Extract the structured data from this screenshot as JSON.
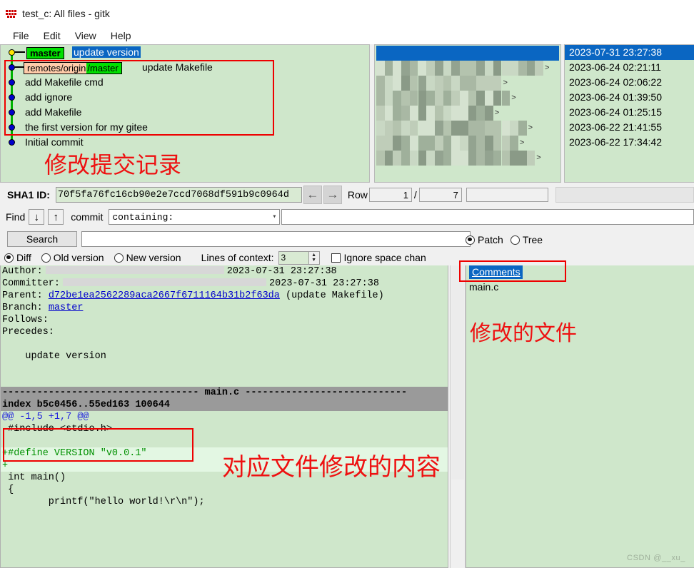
{
  "window": {
    "title": "test_c: All files - gitk",
    "icon": "gitk-app-icon"
  },
  "menubar": {
    "items": [
      "File",
      "Edit",
      "View",
      "Help"
    ]
  },
  "commit_list": {
    "rows": [
      {
        "refs": [
          {
            "text": "master",
            "style": "green"
          }
        ],
        "subject": "update version",
        "subject_highlighted": true,
        "author_redacted": true,
        "date": "2023-07-31 23:27:38",
        "selected": true,
        "node": "head"
      },
      {
        "refs": [
          {
            "text_a": "remotes/origin",
            "text_b": "/master",
            "style": "split"
          }
        ],
        "subject": "update Makefile",
        "subject_highlighted": false,
        "author_redacted": true,
        "date": "2023-06-24 02:21:11",
        "selected": false,
        "node": "commit"
      },
      {
        "refs": [],
        "subject": "add Makefile cmd",
        "subject_highlighted": false,
        "author_redacted": true,
        "date": "2023-06-24 02:06:22",
        "selected": false,
        "node": "commit"
      },
      {
        "refs": [],
        "subject": "add ignore",
        "subject_highlighted": false,
        "author_redacted": true,
        "date": "2023-06-24 01:39:50",
        "selected": false,
        "node": "commit"
      },
      {
        "refs": [],
        "subject": "add Makefile",
        "subject_highlighted": false,
        "author_redacted": true,
        "date": "2023-06-24 01:25:15",
        "selected": false,
        "node": "commit"
      },
      {
        "refs": [],
        "subject": "the first version for my gitee",
        "subject_highlighted": false,
        "author_redacted": true,
        "date": "2023-06-22 21:41:55",
        "selected": false,
        "node": "commit"
      },
      {
        "refs": [],
        "subject": "Initial commit",
        "subject_highlighted": false,
        "author_redacted": true,
        "date": "2023-06-22 17:34:42",
        "selected": false,
        "node": "commit"
      }
    ]
  },
  "sha_row": {
    "label": "SHA1 ID:",
    "value": "70f5fa76fc16cb90e2e7ccd7068df591b9c0964d",
    "back_arrow": "←",
    "forward_arrow": "→",
    "row_label": "Row",
    "row_current": "1",
    "row_separator": "/",
    "row_total": "7",
    "extra_value": ""
  },
  "find_row": {
    "label": "Find",
    "down_arrow": "↓",
    "up_arrow": "↑",
    "scope_label": "commit",
    "mode": "containing:",
    "chevron": "⌄",
    "query": ""
  },
  "search_row": {
    "button": "Search",
    "query": ""
  },
  "options_row": {
    "radios": [
      {
        "label": "Diff",
        "selected": true
      },
      {
        "label": "Old version",
        "selected": false
      },
      {
        "label": "New version",
        "selected": false
      }
    ],
    "context_label": "Lines of context:",
    "context_value": "3",
    "spin_up": "▲",
    "spin_down": "▼",
    "ignore_space_label": "Ignore space chan",
    "ignore_space_checked": false
  },
  "view_mode": {
    "radios": [
      {
        "label": "Patch",
        "selected": true
      },
      {
        "label": "Tree",
        "selected": false
      }
    ]
  },
  "file_list": {
    "items": [
      {
        "label": "Comments",
        "selected": true
      },
      {
        "label": "main.c",
        "selected": false
      }
    ]
  },
  "diff_panel": {
    "header": [
      {
        "key": "Author:",
        "value": "",
        "redacted": true,
        "date": "2023-07-31 23:27:38"
      },
      {
        "key": "Committer:",
        "value": "",
        "redacted": true,
        "date": "2023-07-31 23:27:38"
      }
    ],
    "parent_label": "Parent:",
    "parent_sha": "d72be1ea2562289aca2667f6711164b31b2f63da",
    "parent_subject": "(update Makefile)",
    "branch_label": "Branch:",
    "branch_value": "master",
    "follows_label": "Follows:",
    "precedes_label": "Precedes:",
    "commit_message": "    update version",
    "file_separator": "---------------------------------- main.c ----------------------------",
    "index_line": "index b5c0456..55ed163 100644",
    "hunk_header": "@@ -1,5 +1,7 @@",
    "lines": [
      {
        "text": " #include <stdio.h>",
        "kind": "context"
      },
      {
        "text": "",
        "kind": "context"
      },
      {
        "text": "+#define VERSION \"v0.0.1\"",
        "kind": "add"
      },
      {
        "text": "+",
        "kind": "add"
      },
      {
        "text": " int main()",
        "kind": "context"
      },
      {
        "text": " {",
        "kind": "context"
      },
      {
        "text": "        printf(\"hello world!\\r\\n\");",
        "kind": "context"
      }
    ]
  },
  "annotations": [
    {
      "id": "commit-history",
      "text": "修改提交记录"
    },
    {
      "id": "changed-file",
      "text": "修改的文件"
    },
    {
      "id": "file-diff-content",
      "text": "对应文件修改的内容"
    }
  ],
  "watermark": "CSDN @__xu_",
  "colors": {
    "pane_bg": "#cfe7cb",
    "selection_blue": "#0a66c2",
    "ref_green": "#00e000",
    "ref_orange": "#ffccaa",
    "annotation_red": "#ee0000",
    "add_green": "#009000",
    "link_blue": "#0000cc"
  }
}
